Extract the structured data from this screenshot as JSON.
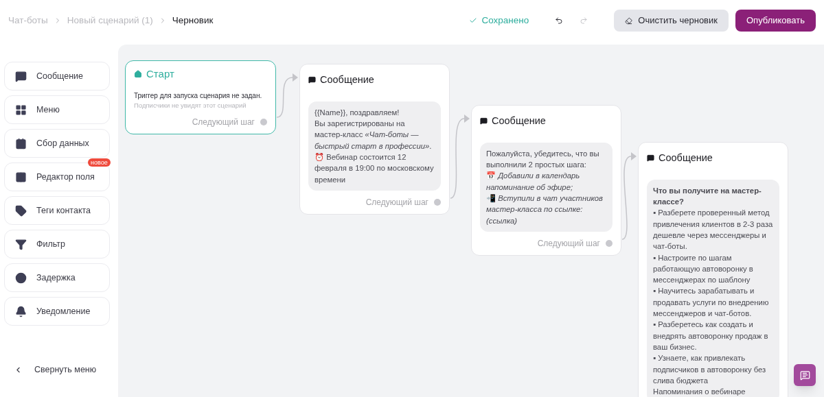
{
  "breadcrumbs": [
    {
      "label": "Чат-боты",
      "current": false
    },
    {
      "label": "Новый сценарий (1)",
      "current": false
    },
    {
      "label": "Черновик",
      "current": true
    }
  ],
  "save_status": "Сохранено",
  "undo": {
    "disabled": false
  },
  "redo": {
    "disabled": true
  },
  "buttons": [
    {
      "label": "Очистить черновик",
      "kind": "secondary"
    },
    {
      "label": "Опубликовать",
      "kind": "primary"
    }
  ],
  "sidebar": {
    "items": [
      {
        "label": "Сообщение"
      },
      {
        "label": "Меню"
      },
      {
        "label": "Сбор данных"
      },
      {
        "label": "Редактор поля",
        "badge": "новое"
      },
      {
        "label": "Теги контакта"
      },
      {
        "label": "Фильтр"
      },
      {
        "label": "Задержка"
      },
      {
        "label": "Уведомление"
      }
    ],
    "collapse": "Свернуть меню"
  },
  "nodes": [
    {
      "kind": "start",
      "title": "Старт",
      "text": "Триггер для запуска сценария не задан.",
      "hint": "Подписчики не увидят этот сценарий",
      "next": "Следующий шаг"
    },
    {
      "kind": "message",
      "title": "Сообщение",
      "paragraphs": [
        "{{Name}}, поздравляем!",
        "Вы зарегистрированы на мастер-класс *«Чат-боты — быстрый старт в профессии»*.",
        "⏰ Вебинар состоится 12 февраля в 19:00 по московскому времени"
      ],
      "next": "Следующий шаг"
    },
    {
      "kind": "message",
      "title": "Сообщение",
      "paragraphs": [
        "Пожалуйста, убедитесь, что вы выполнили 2 простых шага:",
        "📅 *Добавили в календарь напоминание об эфире;*",
        "📲 *Вступили в чат участников мастер-класса по ссылке: (ссылка)*"
      ],
      "next": "Следующий шаг"
    },
    {
      "kind": "message",
      "title": "Сообщение",
      "paragraphs": [
        "**Что вы получите на мастер-классе?**",
        "▪ Разберете проверенный метод привлечения клиентов в 2-3 раза дешевле через мессенджеры и чат-боты.",
        "▪ Настроите по шагам работающую автоворонку в мессенджерах по шаблону",
        "▪ Научитесь зарабатывать и продавать услуги по внедрению мессенджеров и чат-ботов.",
        "▪ Разберетесь как создать и внедрять автоворонку продаж в ваш бизнес.",
        "▪ Узнаете, как привлекать подписчиков в автоворонку без слива бюджета",
        "Напоминания о вебинаре"
      ]
    }
  ]
}
